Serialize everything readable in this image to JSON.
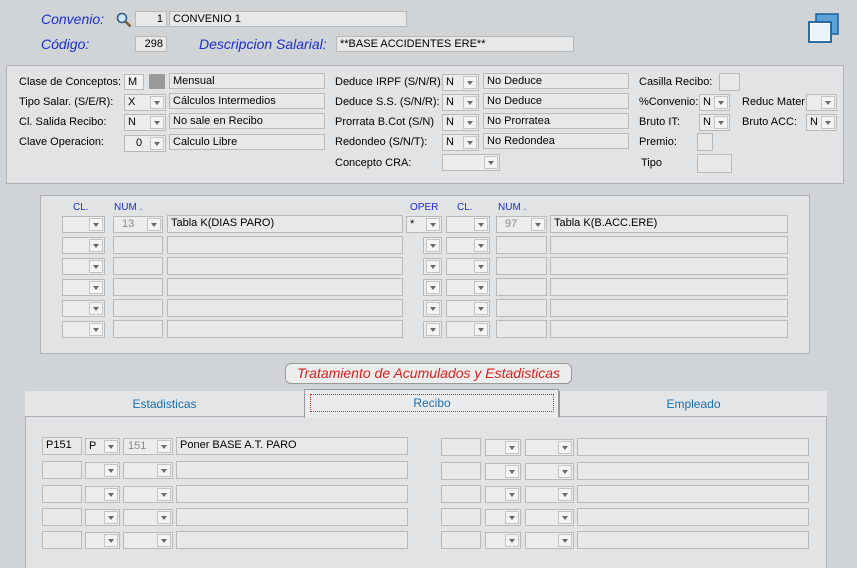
{
  "header": {
    "convenio_label": "Convenio:",
    "convenio_num": "1",
    "convenio_name": "CONVENIO 1",
    "codigo_label": "Código:",
    "codigo_value": "298",
    "desc_label": "Descripcion Salarial:",
    "desc_value": "**BASE ACCIDENTES ERE**"
  },
  "conceptos": {
    "clase_label": "Clase de Conceptos:",
    "clase_code": "M",
    "clase_text": "Mensual",
    "tipo_label": "Tipo Salar. (S/E/R):",
    "tipo_code": "X",
    "tipo_text": "Cálculos Intermedios",
    "salida_label": "Cl. Salida Recibo:",
    "salida_code": "N",
    "salida_text": "No sale en Recibo",
    "clave_label": "Clave Operacion:",
    "clave_code": "0",
    "clave_text": "Calculo Libre",
    "irpf_label": "Deduce IRPF (S/N/R):",
    "irpf_code": "N",
    "irpf_text": "No Deduce",
    "ss_label": "Deduce S.S. (S/N/R):",
    "ss_code": "N",
    "ss_text": "No Deduce",
    "prorrata_label": "Prorrata B.Cot (S/N)",
    "prorrata_code": "N",
    "prorrata_text": "No Prorratea",
    "redondeo_label": "Redondeo (S/N/T):",
    "redondeo_code": "N",
    "redondeo_text": "No Redondea",
    "cra_label": "Concepto CRA:",
    "casilla_label": "Casilla Recibo:",
    "pconvenio_label": "%Convenio:",
    "pconvenio_code": "N",
    "reduc_label": "Reduc Mater",
    "brutoit_label": "Bruto IT:",
    "brutoit_code": "N",
    "brutoacc_label": "Bruto ACC:",
    "brutoacc_code": "N",
    "premio_label": "Premio:",
    "tipo2_label": "Tipo"
  },
  "formula": {
    "headers": {
      "cl1": "CL.",
      "num1": "NUM .",
      "oper": "OPER",
      "cl2": "CL.",
      "num2": "NUM ."
    },
    "row1": {
      "num1": "13",
      "desc1": "Tabla K(DIAS PARO)",
      "oper": "*",
      "num2": "97",
      "desc2": "Tabla K(B.ACC.ERE)"
    }
  },
  "acumulados": {
    "title": "Tratamiento de Acumulados y Estadisticas",
    "tabs": [
      "Estadisticas",
      "Recibo",
      "Empleado"
    ],
    "row1": {
      "code": "P151",
      "tipo": "P",
      "num": "151",
      "desc": "Poner  BASE A.T. PARO"
    }
  }
}
